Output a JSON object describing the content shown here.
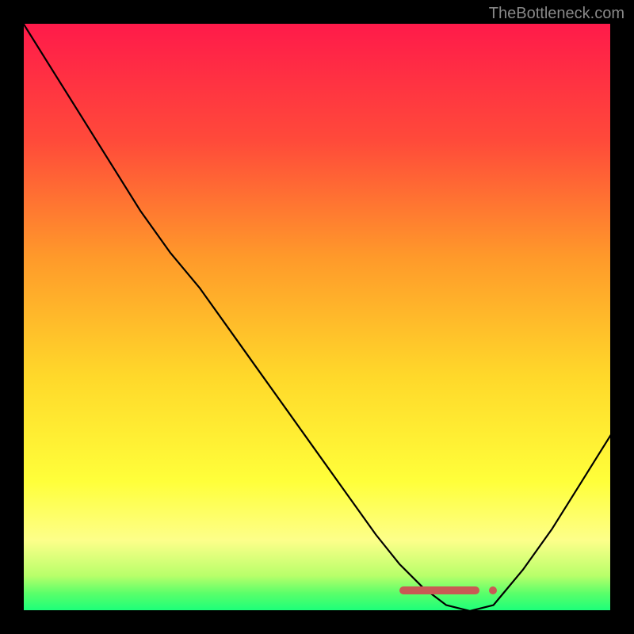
{
  "watermark": "TheBottleneck.com",
  "chart_data": {
    "type": "line",
    "title": "",
    "xlabel": "",
    "ylabel": "",
    "xlim": [
      0,
      100
    ],
    "ylim": [
      0,
      100
    ],
    "x": [
      0,
      5,
      10,
      15,
      20,
      25,
      30,
      35,
      40,
      45,
      50,
      55,
      60,
      64,
      68,
      72,
      76,
      80,
      85,
      90,
      95,
      100
    ],
    "values": [
      100,
      92,
      84,
      76,
      68,
      61,
      55,
      48,
      41,
      34,
      27,
      20,
      13,
      8,
      4,
      1,
      0,
      1,
      7,
      14,
      22,
      30
    ],
    "optimal_range": [
      64,
      80
    ],
    "gradient_stops": [
      {
        "pos": 0,
        "color": "#ff1a4a"
      },
      {
        "pos": 20,
        "color": "#ff4a3a"
      },
      {
        "pos": 40,
        "color": "#ff9a2a"
      },
      {
        "pos": 60,
        "color": "#ffd82a"
      },
      {
        "pos": 78,
        "color": "#ffff3a"
      },
      {
        "pos": 88,
        "color": "#fdff8a"
      },
      {
        "pos": 94,
        "color": "#b8ff6a"
      },
      {
        "pos": 97,
        "color": "#5aff6a"
      },
      {
        "pos": 100,
        "color": "#1aff7a"
      }
    ]
  }
}
